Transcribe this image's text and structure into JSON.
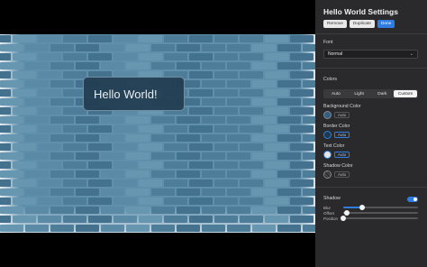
{
  "canvas": {
    "tooltip_text": "Hello World!"
  },
  "panel": {
    "title": "Hello World Settings",
    "actions": {
      "remove": "Remove",
      "duplicate": "Duplicate",
      "done": "Done"
    },
    "font": {
      "label": "Font",
      "value": "Normal"
    },
    "colors": {
      "label": "Colors",
      "modes": [
        "Auto",
        "Light",
        "Dark",
        "Custom"
      ],
      "active_mode": "Custom",
      "background": {
        "label": "Background Color",
        "auto_label": "Auto",
        "swatch": "#2d5f83"
      },
      "border": {
        "label": "Border Color",
        "auto_label": "Auto",
        "swatch": "#1e3a52"
      },
      "text": {
        "label": "Text Color",
        "auto_label": "Auto",
        "swatch": "#e3e7ea"
      },
      "shadow": {
        "label": "Shadow Color",
        "auto_label": "Auto"
      }
    },
    "shadow": {
      "label": "Shadow",
      "enabled": true,
      "sliders": [
        {
          "label": "Blur",
          "value": 0.25
        },
        {
          "label": "Offset",
          "value": 0.05
        },
        {
          "label": "Position",
          "value": 0.0
        }
      ]
    }
  },
  "accent": "#2f7de1"
}
